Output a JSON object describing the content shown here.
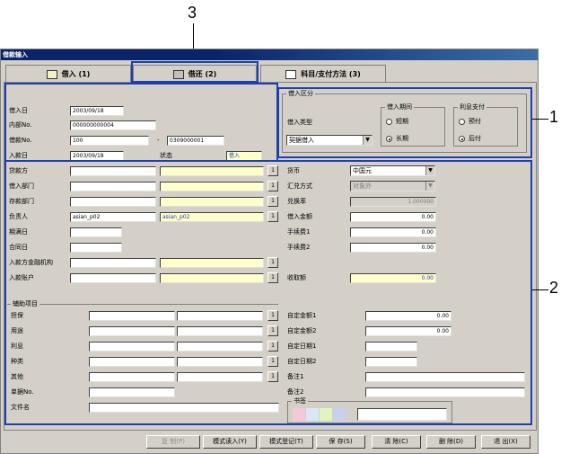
{
  "callouts": {
    "n1": "1",
    "n2": "2",
    "n3": "3"
  },
  "window": {
    "title": "借款输入"
  },
  "tabs": [
    {
      "label": "借入 (1)"
    },
    {
      "label": "借还 (2)"
    },
    {
      "label": "科目/支付方法 (3)"
    }
  ],
  "form": {
    "borrow_date_label": "借入日",
    "borrow_date": "2003/09/18",
    "internal_no_label": "内部No.",
    "internal_no": "000000000004",
    "loan_no_label": "借款No.",
    "loan_no": "100",
    "loan_no_sep": "-",
    "loan_no_2": "0309000001",
    "entry_date_label": "入款日",
    "entry_date": "2003/09/18",
    "status_label": "状态",
    "status_value": "借入",
    "lender_label": "贷款方",
    "borrow_dept_label": "借入部门",
    "deposit_dept_label": "存款部门",
    "manager_label": "负责人",
    "manager_code": "asian_p02",
    "manager_name": "asian_p02",
    "due_date_label": "期满日",
    "contract_date_label": "合同日",
    "bank_label": "入款方金融机构",
    "account_label": "入款账户"
  },
  "borrow_section": {
    "title": "借入区分",
    "type_label": "借入类型",
    "type_value": "契据借入",
    "period_title": "借入期间",
    "period_short": "短期",
    "period_long": "长期",
    "interest_title": "利息支付",
    "interest_prepaid": "预付",
    "interest_postpaid": "后付"
  },
  "currency": {
    "currency_label": "货币",
    "currency_value": "中国元",
    "exchange_method_label": "汇兑方式",
    "exchange_method_value": "对象外",
    "rate_label": "兑换率",
    "rate_value": "1.000000",
    "amount_label": "借入金额",
    "amount_value": "0.00",
    "fee1_label": "手续费1",
    "fee1_value": "0.00",
    "fee2_label": "手续费2",
    "fee2_value": "0.00",
    "received_label": "收取额",
    "received_value": "0.00"
  },
  "aux": {
    "title": "辅助项目",
    "guarantee_label": "担保",
    "purpose_label": "用途",
    "interest_label": "利息",
    "kind_label": "种类",
    "other_label": "其他",
    "doc_no_label": "单据No.",
    "file_name_label": "文件名",
    "custom_amount1_label": "自定金额1",
    "custom_amount1": "0.00",
    "custom_amount2_label": "自定金额2",
    "custom_amount2": "0.00",
    "custom_date1_label": "自定日期1",
    "custom_date2_label": "自定日期2",
    "note1_label": "备注1",
    "note2_label": "备注2",
    "bookmark_label": "书签",
    "bookmark_colors": [
      "#f4c8d8",
      "#d8e8f8",
      "#e0f4c0",
      "#c8d0f0"
    ]
  },
  "buttons": {
    "copy": "复 制(P)",
    "load_pattern": "模式读入(Y)",
    "save_pattern": "模式登记(T)",
    "save": "保 存(S)",
    "clear": "清 除(C)",
    "delete": "删 除(D)",
    "exit": "退 出(X)"
  }
}
